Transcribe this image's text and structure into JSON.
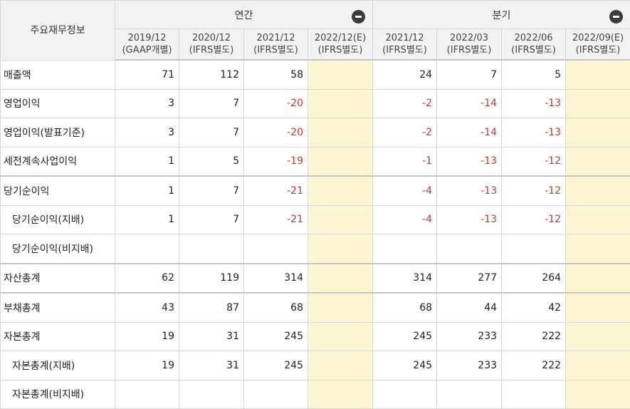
{
  "header": {
    "corner": "주요재무정보",
    "groups": [
      {
        "label": "연간"
      },
      {
        "label": "분기"
      }
    ],
    "columns": [
      {
        "period": "2019/12",
        "basis": "(GAAP개별)"
      },
      {
        "period": "2020/12",
        "basis": "(IFRS별도)"
      },
      {
        "period": "2021/12",
        "basis": "(IFRS별도)"
      },
      {
        "period": "2022/12(E)",
        "basis": "(IFRS별도)"
      },
      {
        "period": "2021/12",
        "basis": "(IFRS별도)"
      },
      {
        "period": "2022/03",
        "basis": "(IFRS별도)"
      },
      {
        "period": "2022/06",
        "basis": "(IFRS별도)"
      },
      {
        "period": "2022/09(E)",
        "basis": "(IFRS별도)"
      }
    ]
  },
  "rows": [
    {
      "label": "매출액",
      "values": [
        "71",
        "112",
        "58",
        "",
        "24",
        "7",
        "5",
        ""
      ]
    },
    {
      "label": "영업이익",
      "values": [
        "3",
        "7",
        "-20",
        "",
        "-2",
        "-14",
        "-13",
        ""
      ]
    },
    {
      "label": "영업이익(발표기준)",
      "values": [
        "3",
        "7",
        "-20",
        "",
        "-2",
        "-14",
        "-13",
        ""
      ]
    },
    {
      "label": "세전계속사업이익",
      "values": [
        "1",
        "5",
        "-19",
        "",
        "-1",
        "-13",
        "-12",
        ""
      ]
    },
    {
      "label": "당기순이익",
      "values": [
        "1",
        "7",
        "-21",
        "",
        "-4",
        "-13",
        "-12",
        ""
      ]
    },
    {
      "label": "당기순이익(지배)",
      "values": [
        "1",
        "7",
        "-21",
        "",
        "-4",
        "-13",
        "-12",
        ""
      ]
    },
    {
      "label": "당기순이익(비지배)",
      "values": [
        "",
        "",
        "",
        "",
        "",
        "",
        "",
        ""
      ]
    },
    {
      "label": "자산총계",
      "values": [
        "62",
        "119",
        "314",
        "",
        "314",
        "277",
        "264",
        ""
      ]
    },
    {
      "label": "부채총계",
      "values": [
        "43",
        "87",
        "68",
        "",
        "68",
        "44",
        "42",
        ""
      ]
    },
    {
      "label": "자본총계",
      "values": [
        "19",
        "31",
        "245",
        "",
        "245",
        "233",
        "222",
        ""
      ]
    },
    {
      "label": "자본총계(지배)",
      "values": [
        "19",
        "31",
        "245",
        "",
        "245",
        "233",
        "222",
        ""
      ]
    },
    {
      "label": "자본총계(비지배)",
      "values": [
        "",
        "",
        "",
        "",
        "",
        "",
        "",
        ""
      ]
    }
  ],
  "colors": {
    "negative": "#c0392b",
    "estimate_bg": "#fbf6cf",
    "header_bg": "#f2f2f2"
  }
}
